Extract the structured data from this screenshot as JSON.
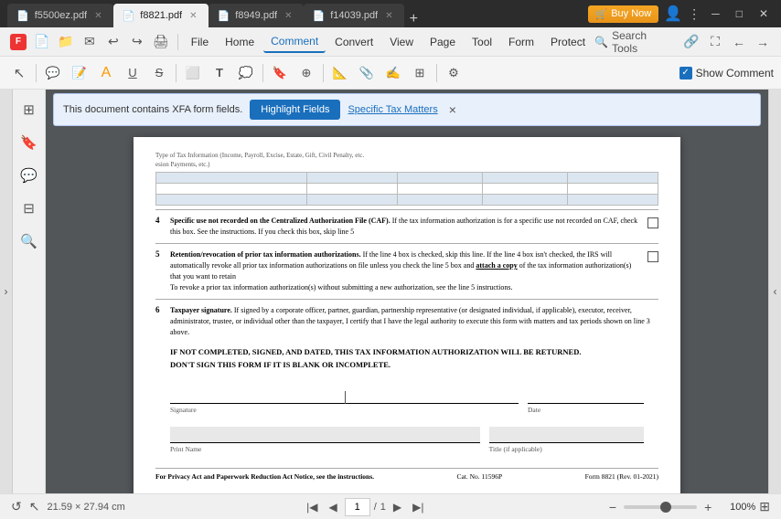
{
  "titlebar": {
    "tabs": [
      {
        "id": "tab1",
        "label": "f5500ez.pdf",
        "active": false,
        "icon": "📄"
      },
      {
        "id": "tab2",
        "label": "f8821.pdf",
        "active": true,
        "icon": "📄"
      },
      {
        "id": "tab3",
        "label": "f8949.pdf",
        "active": false,
        "icon": "📄"
      },
      {
        "id": "tab4",
        "label": "f14039.pdf",
        "active": false,
        "icon": "📄"
      }
    ],
    "buy_now": "Buy Now",
    "win_controls": [
      "─",
      "□",
      "✕"
    ]
  },
  "menubar": {
    "items": [
      "File",
      "Home",
      "Comment",
      "Convert",
      "View",
      "Page",
      "Tool",
      "Form",
      "Protect"
    ],
    "active": "Comment",
    "search_tools": "Search Tools"
  },
  "toolbar": {
    "show_comment_label": "Show Comment"
  },
  "xfa_bar": {
    "message": "This document contains XFA form fields.",
    "highlight_btn": "Highlight Fields",
    "specific_tax": "Specific Tax Matters",
    "close": "×"
  },
  "pdf": {
    "sections": {
      "s4": {
        "num": "4",
        "title": "Specific use not recorded on the Centralized Authorization File (CAF).",
        "text": " If the tax information authorization is for a specific use not recorded on CAF, check this box. See the instructions. If you check this box, skip line 5"
      },
      "s5": {
        "num": "5",
        "title": "Retention/revocation of prior tax information authorizations.",
        "text": " If the line 4 box is checked, skip this line. If the line 4 box isn't checked, the IRS will automatically revoke all prior tax information authorizations on file unless you check the line 5 box and ",
        "bold": "attach a copy",
        "text2": " of the tax information authorization(s) that you want to retain",
        "sub": "To revoke a prior tax information authorization(s) without submitting a new authorization, see the line 5 instructions."
      },
      "s6": {
        "num": "6",
        "title": "Taxpayer signature.",
        "text": " If signed by a corporate officer, partner, guardian, partnership representative (or designated individual, if applicable), executor, receiver, administrator, trustee, or individual other than the taxpayer, I certify that I have the legal authority to execute this form with matters and tax periods shown on line 3 above."
      }
    },
    "signature_block": {
      "warning1": "IF NOT COMPLETED, SIGNED, AND DATED, THIS TAX INFORMATION AUTHORIZATION WILL BE RETURNED.",
      "warning2": "DON'T SIGN THIS FORM IF IT IS BLANK OR INCOMPLETE.",
      "sig_label": "Signature",
      "date_label": "Date",
      "print_name_label": "Print Name",
      "title_label": "Title (if applicable)"
    },
    "footer": {
      "privacy": "For Privacy Act and Paperwork Reduction Act Notice, see the instructions.",
      "cat": "Cat. No. 11596P",
      "form": "Form 8821 (Rev. 01-2021)"
    },
    "table_headers": [
      "Type of Tax Information (Income, Payroll, Excise, Estate, Gift, Civil Penalty, etc.)",
      "",
      "",
      "",
      ""
    ],
    "table_sub": "esion Payments, etc.)"
  },
  "statusbar": {
    "size": "21.59 × 27.94 cm",
    "page_current": "1",
    "page_total": "1",
    "zoom_pct": "100%"
  }
}
